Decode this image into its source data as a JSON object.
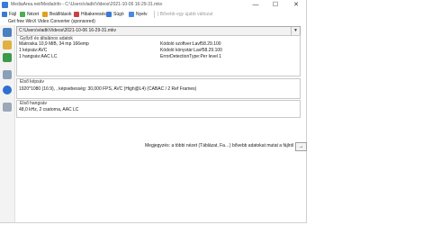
{
  "window": {
    "title": "MediaArea.net/MediaInfo - C:\\Users\\vladk\\Videos\\2021-10-06 16-29-31.mkv",
    "minimize_glyph": "—",
    "maximize_glyph": "☐",
    "close_glyph": "✕"
  },
  "menu": {
    "items": [
      {
        "label": "Fájl",
        "icon": "file-icon",
        "color": "#3a7bd5"
      },
      {
        "label": "Nézet",
        "icon": "view-icon",
        "color": "#4caf50"
      },
      {
        "label": "Beállítások",
        "icon": "settings-icon",
        "color": "#e0a020"
      },
      {
        "label": "Hibakeresés",
        "icon": "debug-icon",
        "color": "#d04040"
      },
      {
        "label": "Súgó",
        "icon": "help-icon",
        "color": "#3a7bd5"
      },
      {
        "label": "Nyelv",
        "icon": "language-icon",
        "color": "#4a8ae0"
      }
    ],
    "hint": "| Bővebb egy újabb változat"
  },
  "promo_text": "Get free WinX Video Converter (sponsored)",
  "file_selector": {
    "value": "C:\\Users\\vladk\\Videos\\2021-10-06 16-29-31.mkv",
    "arrow": "▼"
  },
  "toolbar_icons": [
    "open-file-icon",
    "open-folder-icon",
    "export-icon",
    "sheet-icon",
    "info-icon",
    "preferences-icon"
  ],
  "general": {
    "title": "Győző és általános adatok",
    "left": [
      "Matroska 10,9 MiB, 34 mp 166emp",
      "1 képsáv:AVC",
      "1 hangsáv:AAC LC"
    ],
    "right": [
      "Kódoló szoftver:Lavf58.29.100",
      "Kódoló könyvtár:Lavf58.29.100",
      "ErrorDetectionType:Per level 1"
    ]
  },
  "video": {
    "title": "Első képsáv",
    "detail": "1920*1080 (16:9), , képsebesség: 30,000 FPS, AVC (High@L4) (CABAC / 2 Ref Frames)"
  },
  "audio": {
    "title": "Első hangsáv",
    "detail": "48,0 kHz, 2 csatorna, AAC LC"
  },
  "footer": {
    "note": "Megjegyzés: a többi nézet (Táblázat, Fa…) bővebb adatokat mutat a fájlról",
    "button": "→"
  }
}
